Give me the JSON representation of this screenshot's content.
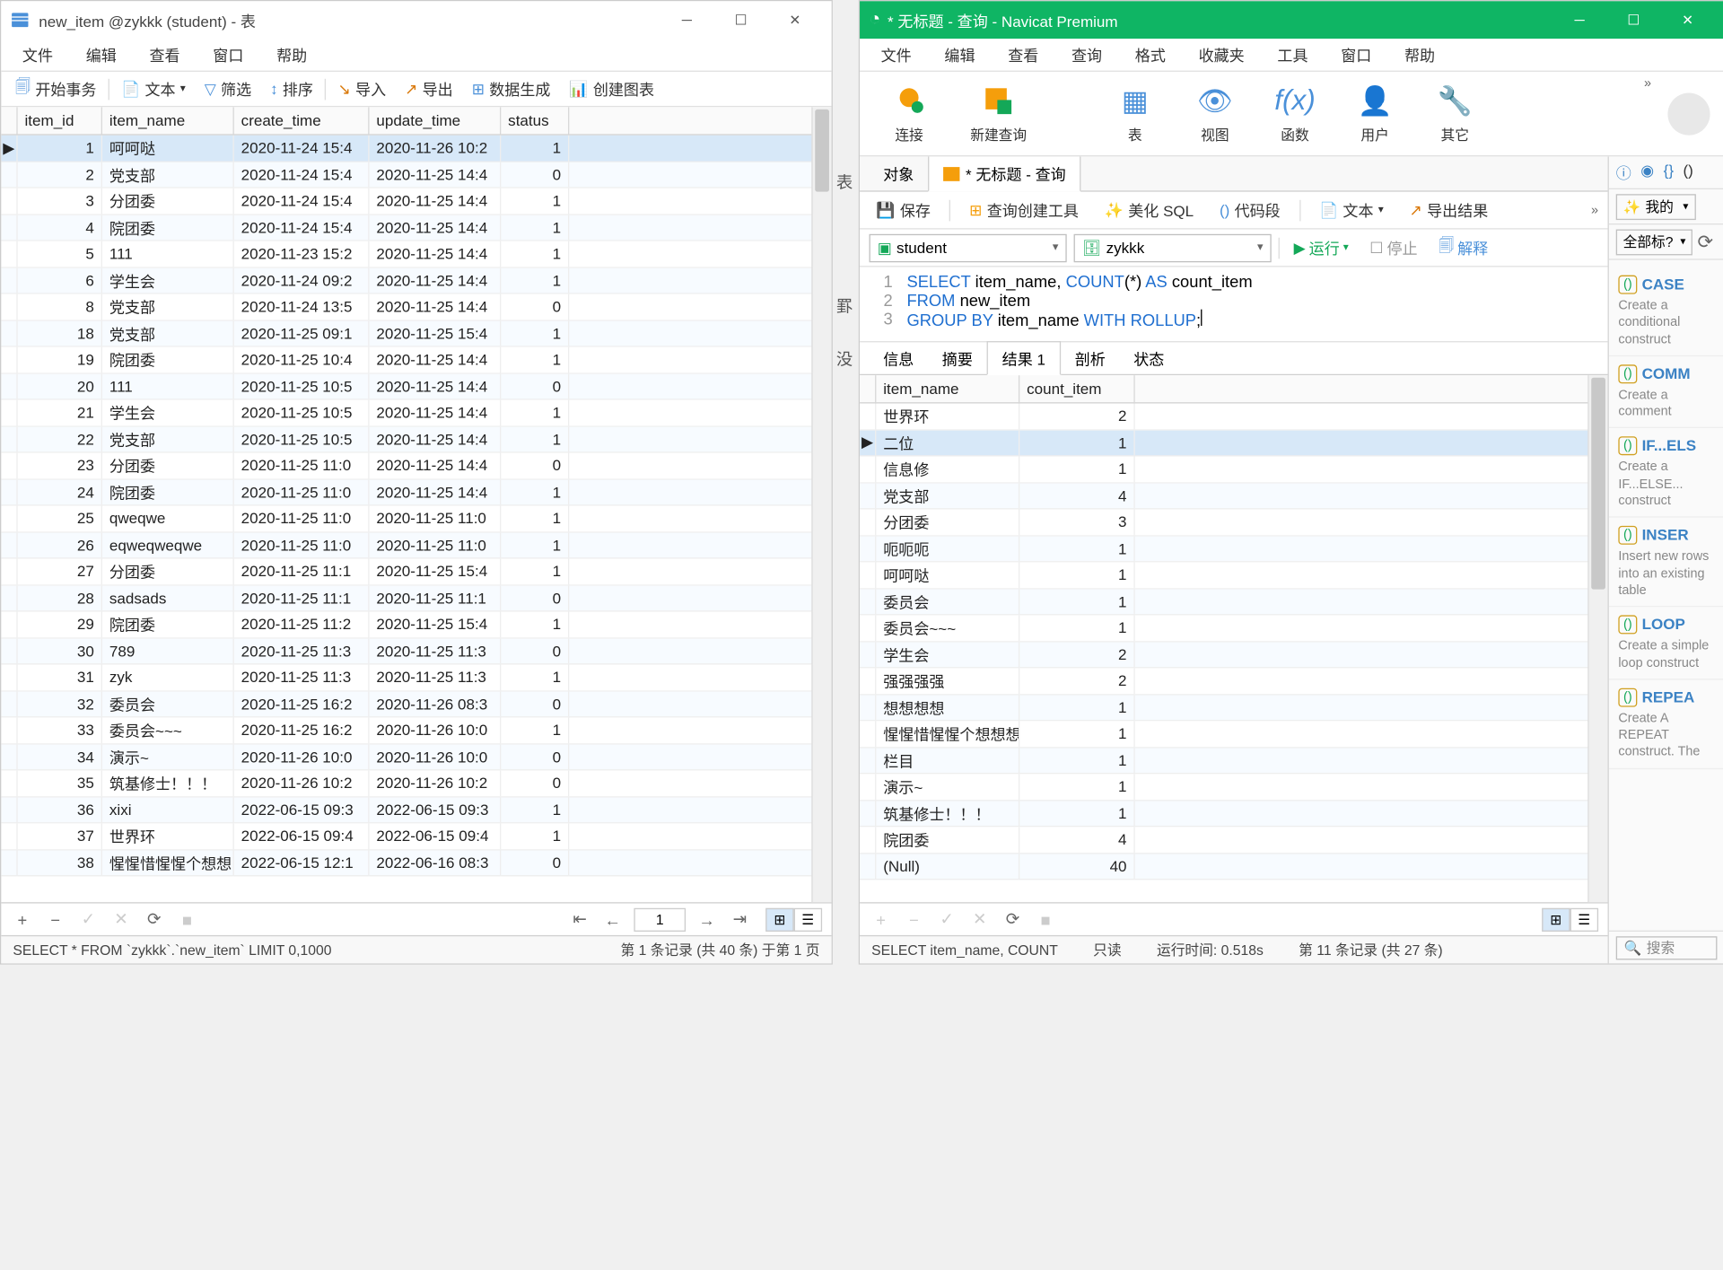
{
  "left": {
    "title": "new_item @zykkk (student) - 表",
    "menu": [
      "文件",
      "编辑",
      "查看",
      "窗口",
      "帮助"
    ],
    "toolbar": {
      "begin_tx": "开始事务",
      "text": "文本",
      "filter": "筛选",
      "sort": "排序",
      "import": "导入",
      "export": "导出",
      "gen": "数据生成",
      "chart": "创建图表"
    },
    "columns": [
      "item_id",
      "item_name",
      "create_time",
      "update_time",
      "status"
    ],
    "rows": [
      {
        "id": 1,
        "name": "呵呵哒",
        "ct": "2020-11-24 15:4",
        "ut": "2020-11-26 10:2",
        "st": 1,
        "sel": true
      },
      {
        "id": 2,
        "name": "党支部",
        "ct": "2020-11-24 15:4",
        "ut": "2020-11-25 14:4",
        "st": 0
      },
      {
        "id": 3,
        "name": "分团委",
        "ct": "2020-11-24 15:4",
        "ut": "2020-11-25 14:4",
        "st": 1
      },
      {
        "id": 4,
        "name": "院团委",
        "ct": "2020-11-24 15:4",
        "ut": "2020-11-25 14:4",
        "st": 1
      },
      {
        "id": 5,
        "name": "111",
        "ct": "2020-11-23 15:2",
        "ut": "2020-11-25 14:4",
        "st": 1
      },
      {
        "id": 6,
        "name": "学生会",
        "ct": "2020-11-24 09:2",
        "ut": "2020-11-25 14:4",
        "st": 1
      },
      {
        "id": 8,
        "name": "党支部",
        "ct": "2020-11-24 13:5",
        "ut": "2020-11-25 14:4",
        "st": 0
      },
      {
        "id": 18,
        "name": "党支部",
        "ct": "2020-11-25 09:1",
        "ut": "2020-11-25 15:4",
        "st": 1
      },
      {
        "id": 19,
        "name": "院团委",
        "ct": "2020-11-25 10:4",
        "ut": "2020-11-25 14:4",
        "st": 1
      },
      {
        "id": 20,
        "name": "111",
        "ct": "2020-11-25 10:5",
        "ut": "2020-11-25 14:4",
        "st": 0
      },
      {
        "id": 21,
        "name": "学生会",
        "ct": "2020-11-25 10:5",
        "ut": "2020-11-25 14:4",
        "st": 1
      },
      {
        "id": 22,
        "name": "党支部",
        "ct": "2020-11-25 10:5",
        "ut": "2020-11-25 14:4",
        "st": 1
      },
      {
        "id": 23,
        "name": "分团委",
        "ct": "2020-11-25 11:0",
        "ut": "2020-11-25 14:4",
        "st": 0
      },
      {
        "id": 24,
        "name": "院团委",
        "ct": "2020-11-25 11:0",
        "ut": "2020-11-25 14:4",
        "st": 1
      },
      {
        "id": 25,
        "name": "qweqwe",
        "ct": "2020-11-25 11:0",
        "ut": "2020-11-25 11:0",
        "st": 1
      },
      {
        "id": 26,
        "name": "eqweqweqwe",
        "ct": "2020-11-25 11:0",
        "ut": "2020-11-25 11:0",
        "st": 1
      },
      {
        "id": 27,
        "name": "分团委",
        "ct": "2020-11-25 11:1",
        "ut": "2020-11-25 15:4",
        "st": 1
      },
      {
        "id": 28,
        "name": "sadsads",
        "ct": "2020-11-25 11:1",
        "ut": "2020-11-25 11:1",
        "st": 0
      },
      {
        "id": 29,
        "name": "院团委",
        "ct": "2020-11-25 11:2",
        "ut": "2020-11-25 15:4",
        "st": 1
      },
      {
        "id": 30,
        "name": "789",
        "ct": "2020-11-25 11:3",
        "ut": "2020-11-25 11:3",
        "st": 0
      },
      {
        "id": 31,
        "name": "zyk",
        "ct": "2020-11-25 11:3",
        "ut": "2020-11-25 11:3",
        "st": 1
      },
      {
        "id": 32,
        "name": "委员会",
        "ct": "2020-11-25 16:2",
        "ut": "2020-11-26 08:3",
        "st": 0
      },
      {
        "id": 33,
        "name": "委员会~~~",
        "ct": "2020-11-25 16:2",
        "ut": "2020-11-26 10:0",
        "st": 1
      },
      {
        "id": 34,
        "name": "演示~",
        "ct": "2020-11-26 10:0",
        "ut": "2020-11-26 10:0",
        "st": 0
      },
      {
        "id": 35,
        "name": "筑基修士！！！",
        "ct": "2020-11-26 10:2",
        "ut": "2020-11-26 10:2",
        "st": 0
      },
      {
        "id": 36,
        "name": "xixi",
        "ct": "2022-06-15 09:3",
        "ut": "2022-06-15 09:3",
        "st": 1
      },
      {
        "id": 37,
        "name": "世界环",
        "ct": "2022-06-15 09:4",
        "ut": "2022-06-15 09:4",
        "st": 1
      },
      {
        "id": 38,
        "name": "惺惺惜惺惺个想想",
        "ct": "2022-06-15 12:1",
        "ut": "2022-06-16 08:3",
        "st": 0
      }
    ],
    "footer": {
      "page": "1",
      "sql": "SELECT * FROM `zykkk`.`new_item` LIMIT 0,1000",
      "records": "第 1 条记录 (共 40 条) 于第 1 页"
    }
  },
  "right": {
    "title": "* 无标题 - 查询 - Navicat Premium",
    "menu": [
      "文件",
      "编辑",
      "查看",
      "查询",
      "格式",
      "收藏夹",
      "工具",
      "窗口",
      "帮助"
    ],
    "bigtool": {
      "connect": "连接",
      "newquery": "新建查询",
      "table": "表",
      "view": "视图",
      "func": "函数",
      "user": "用户",
      "other": "其它"
    },
    "tabs": {
      "objects": "对象",
      "query": "* 无标题 - 查询"
    },
    "qtb": {
      "save": "保存",
      "builder": "查询创建工具",
      "beautify": "美化 SQL",
      "snippet": "代码段",
      "text": "文本",
      "export": "导出结果"
    },
    "combos": {
      "conn": "student",
      "db": "zykkk"
    },
    "run": "运行",
    "stop": "停止",
    "explain": "解释",
    "sql": {
      "l1": "SELECT item_name, COUNT(*) AS count_item",
      "l2": "FROM new_item",
      "l3": "GROUP BY item_name WITH ROLLUP;"
    },
    "rtabs": [
      "信息",
      "摘要",
      "结果 1",
      "剖析",
      "状态"
    ],
    "rcols": [
      "item_name",
      "count_item"
    ],
    "rrows": [
      {
        "n": "世界环",
        "c": 2
      },
      {
        "n": "二位",
        "c": 1,
        "sel": true
      },
      {
        "n": "信息修",
        "c": 1
      },
      {
        "n": "党支部",
        "c": 4
      },
      {
        "n": "分团委",
        "c": 3
      },
      {
        "n": "呃呃呃",
        "c": 1
      },
      {
        "n": "呵呵哒",
        "c": 1
      },
      {
        "n": "委员会",
        "c": 1
      },
      {
        "n": "委员会~~~",
        "c": 1
      },
      {
        "n": "学生会",
        "c": 2
      },
      {
        "n": "强强强强",
        "c": 2
      },
      {
        "n": "想想想想",
        "c": 1
      },
      {
        "n": "惺惺惜惺惺个想想想",
        "c": 1
      },
      {
        "n": "栏目",
        "c": 1
      },
      {
        "n": "演示~",
        "c": 1
      },
      {
        "n": "筑基修士！！！",
        "c": 1
      },
      {
        "n": "院团委",
        "c": 4
      },
      {
        "n": "(Null)",
        "c": 40,
        "null": true
      }
    ],
    "status": {
      "sql": "SELECT item_name, COUNT",
      "readonly": "只读",
      "runtime": "运行时间: 0.518s",
      "records": "第 11 条记录 (共 27 条)"
    },
    "panel": {
      "my": "我的",
      "all": "全部标?",
      "snippets": [
        {
          "t": "CASE",
          "d": "Create a conditional construct"
        },
        {
          "t": "COMM",
          "d": "Create a comment"
        },
        {
          "t": "IF...ELS",
          "d": "Create a IF...ELSE... construct"
        },
        {
          "t": "INSER",
          "d": "Insert new rows into an existing table"
        },
        {
          "t": "LOOP",
          "d": "Create a simple loop construct"
        },
        {
          "t": "REPEA",
          "d": "Create A REPEAT construct. The"
        }
      ],
      "search": "搜索"
    }
  }
}
